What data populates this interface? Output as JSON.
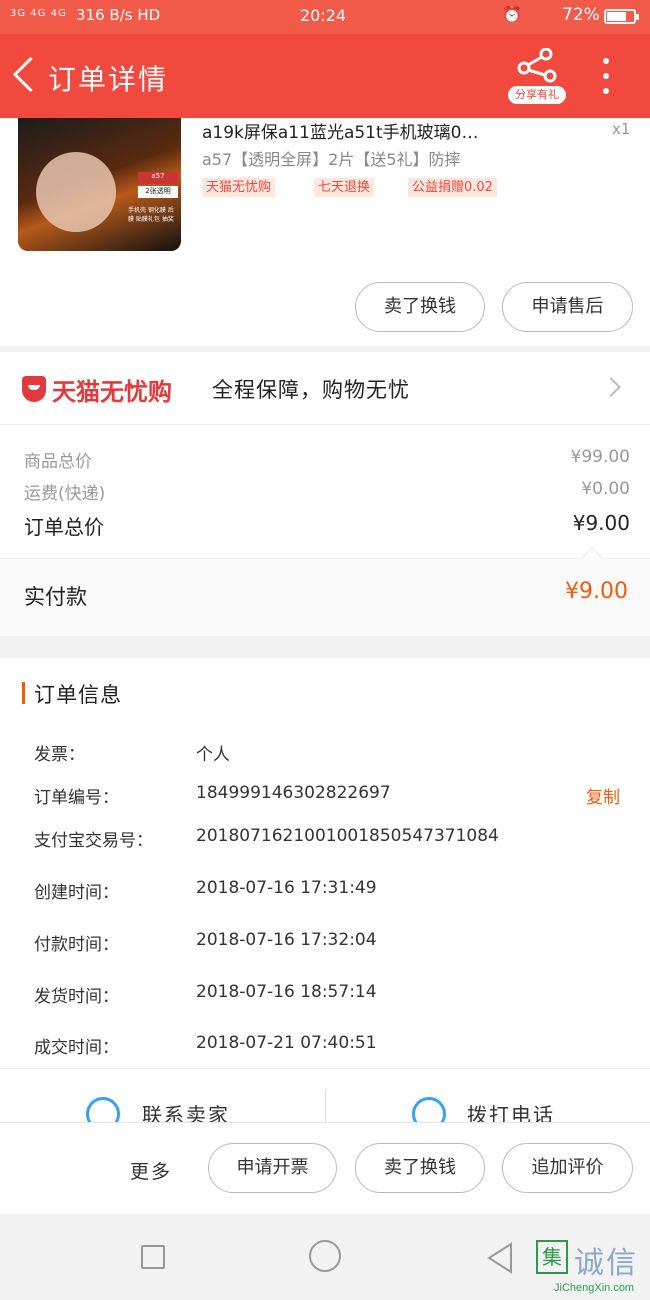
{
  "status_bar": {
    "signal": "3G 4G 4G",
    "network_speed": "316 B/s",
    "hd": "HD",
    "time": "20:24",
    "battery": "72%",
    "battery_level": 0.72
  },
  "header": {
    "title": "订单详情",
    "share_label": "分享有礼"
  },
  "product": {
    "title": "a19k屏保a11蓝光a51t手机玻璃0…",
    "quantity": "x1",
    "spec": "a57【透明全屏】2片【送5礼】防摔",
    "badges": [
      "天猫无忧购",
      "七天退换",
      "公益捐赠0.02"
    ],
    "thumb_tag1": "a57",
    "thumb_tag2": "2张透明",
    "thumb_footer": "手机壳 钢化膜 后膜 贴膜礼包 抽奖",
    "buttons": [
      "卖了换钱",
      "申请售后"
    ]
  },
  "tmall": {
    "name": "天猫无忧购",
    "slogan": "全程保障，购物无忧"
  },
  "prices": {
    "goods_total_label": "商品总价",
    "goods_total": "¥99.00",
    "shipping_label": "运费(快递)",
    "shipping": "¥0.00",
    "order_total_label": "订单总价",
    "order_total": "¥9.00",
    "paid_label": "实付款",
    "paid": "¥9.00"
  },
  "order_info": {
    "title": "订单信息",
    "copy_label": "复制",
    "rows": [
      {
        "label": "发票：",
        "value": "个人"
      },
      {
        "label": "订单编号：",
        "value": "184999146302822697"
      },
      {
        "label": "支付宝交易号：",
        "value": "2018071621001001850547371084"
      },
      {
        "label": "创建时间：",
        "value": "2018-07-16 17:31:49"
      },
      {
        "label": "付款时间：",
        "value": "2018-07-16 17:32:04"
      },
      {
        "label": "发货时间：",
        "value": "2018-07-16 18:57:14"
      },
      {
        "label": "成交时间：",
        "value": "2018-07-21 07:40:51"
      }
    ]
  },
  "contact": {
    "seller": "联系卖家",
    "call": "拨打电话"
  },
  "action_bar": {
    "more": "更多",
    "buttons": [
      "申请开票",
      "卖了换钱",
      "追加评价"
    ]
  },
  "watermark": {
    "cn": "诚信",
    "logo": "集",
    "en": "JiChengXin.com"
  },
  "colors": {
    "brand_red": "#f2493f",
    "price_orange": "#f25a0c",
    "tmall_red": "#e4393c",
    "contact_blue": "#3aa0f0"
  }
}
